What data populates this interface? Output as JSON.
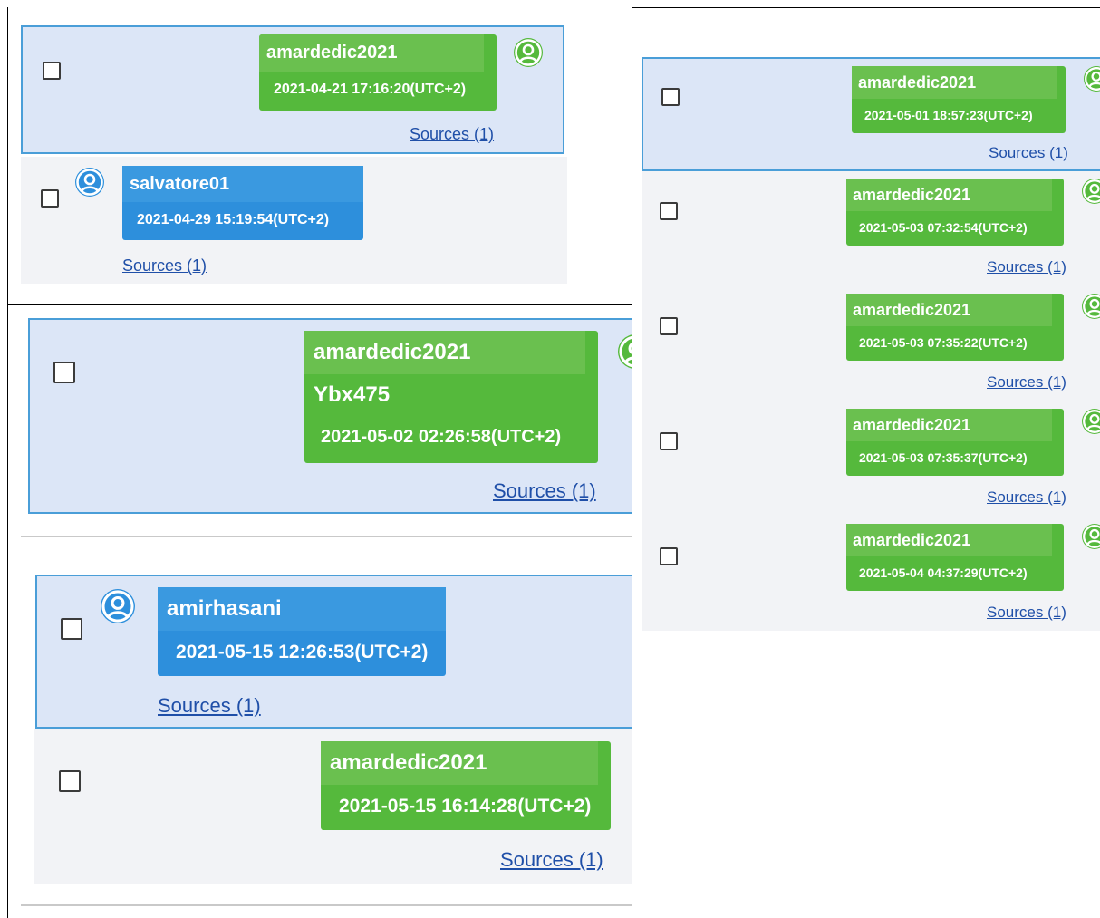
{
  "sources_label": "Sources (1)",
  "colors": {
    "green": "#55b93c",
    "blue": "#2d8fdc",
    "selected_bg": "#dce6f7",
    "selected_border": "#4a9ed8",
    "link": "#1f4fa8"
  },
  "icons": {
    "avatar": "user-avatar-icon",
    "checkbox": "checkbox-icon"
  },
  "frame_a": {
    "messages": [
      {
        "user": "amardedic2021",
        "time": "2021-04-21 17:16:20(UTC+2)"
      },
      {
        "user": "salvatore01",
        "time": "2021-04-29 15:19:54(UTC+2)"
      }
    ]
  },
  "frame_b": {
    "messages": [
      {
        "user": "amardedic2021",
        "body": "Ybx475",
        "time": "2021-05-02 02:26:58(UTC+2)"
      }
    ]
  },
  "frame_c": {
    "messages": [
      {
        "user": "amirhasani",
        "time": "2021-05-15 12:26:53(UTC+2)"
      },
      {
        "user": "amardedic2021",
        "time": "2021-05-15 16:14:28(UTC+2)"
      }
    ]
  },
  "frame_d": {
    "messages": [
      {
        "user": "amardedic2021",
        "time": "2021-05-01 18:57:23(UTC+2)"
      },
      {
        "user": "amardedic2021",
        "time": "2021-05-03 07:32:54(UTC+2)"
      },
      {
        "user": "amardedic2021",
        "time": "2021-05-03 07:35:22(UTC+2)"
      },
      {
        "user": "amardedic2021",
        "time": "2021-05-03 07:35:37(UTC+2)"
      },
      {
        "user": "amardedic2021",
        "time": "2021-05-04 04:37:29(UTC+2)"
      }
    ]
  }
}
